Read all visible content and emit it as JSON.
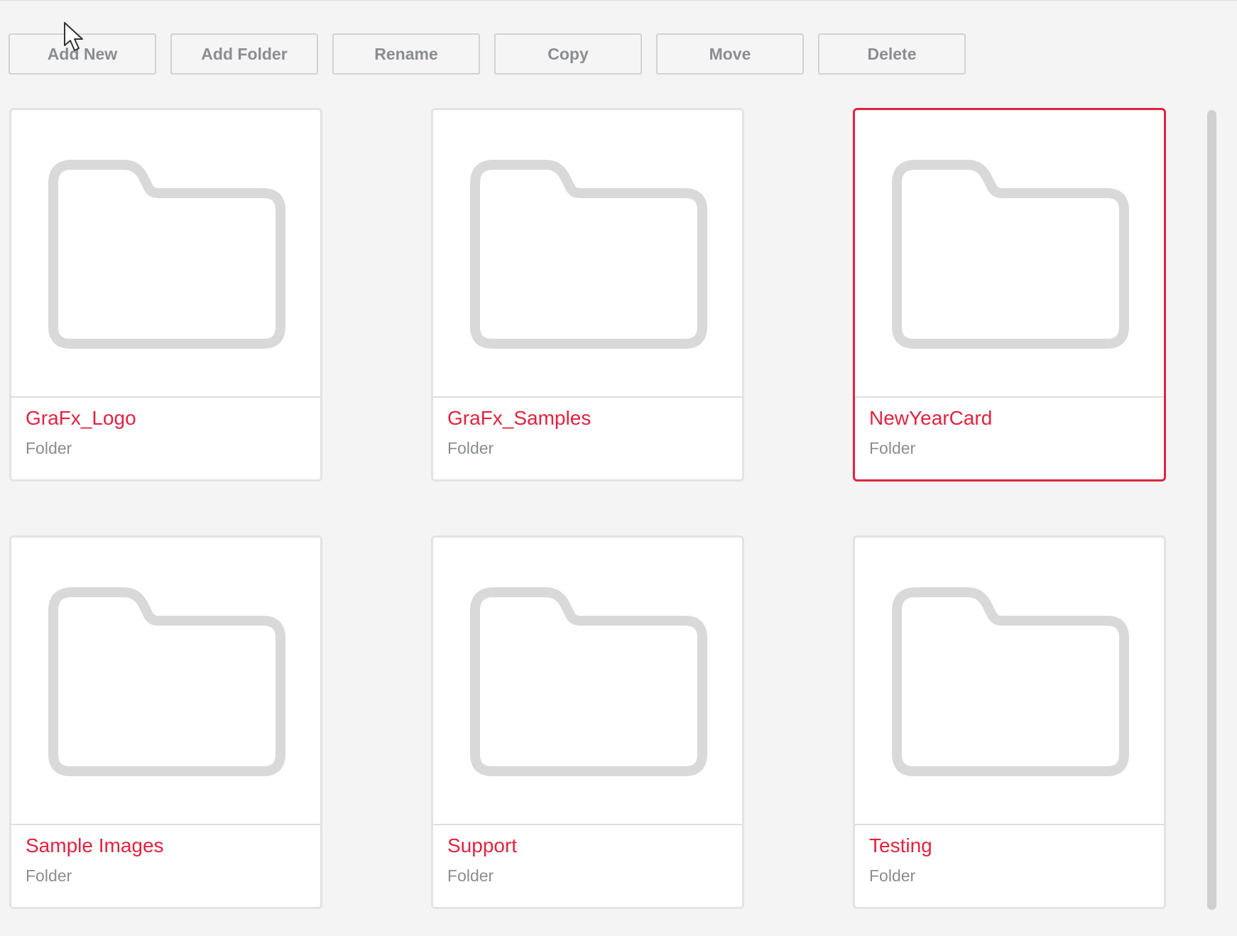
{
  "toolbar": {
    "buttons": [
      {
        "name": "add-new-button",
        "label": "Add New"
      },
      {
        "name": "add-folder-button",
        "label": "Add Folder"
      },
      {
        "name": "rename-button",
        "label": "Rename"
      },
      {
        "name": "copy-button",
        "label": "Copy"
      },
      {
        "name": "move-button",
        "label": "Move"
      },
      {
        "name": "delete-button",
        "label": "Delete"
      }
    ]
  },
  "grid": {
    "items": [
      {
        "name": "GraFx_Logo",
        "type": "Folder",
        "selected": false
      },
      {
        "name": "GraFx_Samples",
        "type": "Folder",
        "selected": false
      },
      {
        "name": "NewYearCard",
        "type": "Folder",
        "selected": true
      },
      {
        "name": "Sample Images",
        "type": "Folder",
        "selected": false
      },
      {
        "name": "Support",
        "type": "Folder",
        "selected": false
      },
      {
        "name": "Testing",
        "type": "Folder",
        "selected": false
      }
    ],
    "icon": "folder-icon"
  },
  "colors": {
    "accent": "#e2223f",
    "muted_text": "#8a8d91",
    "background": "#f4f4f4",
    "icon_stroke": "#d9d9d9"
  }
}
